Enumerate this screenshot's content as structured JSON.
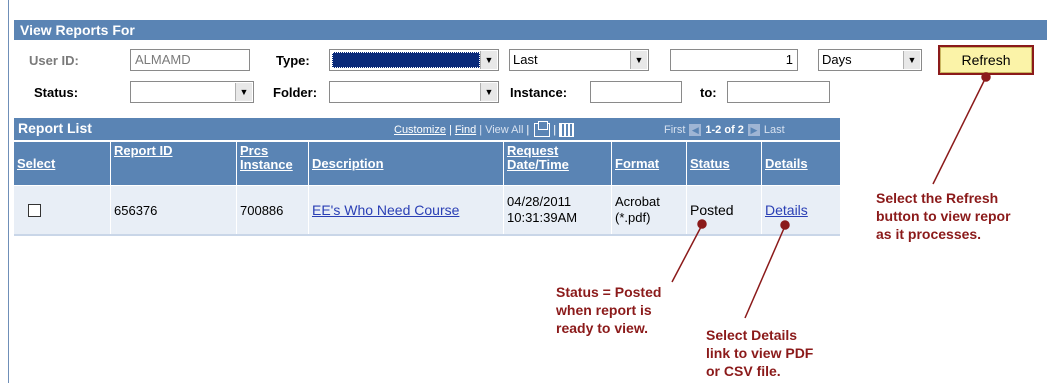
{
  "panel": {
    "title": "View Reports For"
  },
  "filters": {
    "user_id_label": "User ID:",
    "user_id_value": "ALMAMD",
    "type_label": "Type:",
    "type_value": "",
    "period_value": "Last",
    "count_value": "1",
    "unit_value": "Days",
    "refresh_label": "Refresh",
    "status_label": "Status:",
    "status_value": "",
    "folder_label": "Folder:",
    "folder_value": "",
    "instance_label": "Instance:",
    "instance_from": "",
    "to_label": "to:",
    "instance_to": ""
  },
  "report_list": {
    "title": "Report List",
    "nav": {
      "customize": "Customize",
      "sep1": "|",
      "find": "Find",
      "sep2": "|",
      "view_all": "View All",
      "sep3": "|",
      "first": "First",
      "range": "1-2 of 2",
      "last": "Last"
    },
    "columns": [
      "Select",
      "Report ID",
      "Prcs Instance",
      "Description",
      "Request Date/Time",
      "Format",
      "Status",
      "Details"
    ],
    "rows": [
      {
        "report_id": "656376",
        "prcs_instance": "700886",
        "description": "EE's Who Need Course",
        "date": "04/28/2011",
        "time": "10:31:39AM",
        "format_1": "Acrobat",
        "format_2": "(*.pdf)",
        "status": "Posted",
        "details": "Details"
      }
    ]
  },
  "annotations": {
    "refresh_note": "Select the Refresh\nbutton to view repor\nas it processes.",
    "status_note": "Status = Posted\nwhen report is\nready to view.",
    "details_note": "Select Details\nlink to view PDF\nor CSV file."
  },
  "colors": {
    "header": "#5a84b4",
    "annotation": "#8b1a1a",
    "row_bg": "#e8eef6",
    "refresh_bg": "#fbf3a8"
  }
}
